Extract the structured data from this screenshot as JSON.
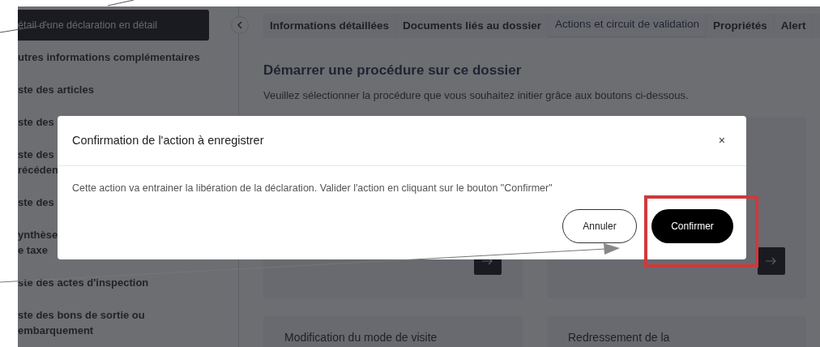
{
  "sidebar": {
    "items": [
      {
        "lines": [
          "étail d'une déclaration en détail"
        ],
        "selected": true
      },
      {
        "lines": [
          "utres informations complémentaires"
        ],
        "selected": false
      },
      {
        "lines": [
          "ste des articles"
        ],
        "selected": false
      },
      {
        "lines": [
          "ste des"
        ],
        "selected": false
      },
      {
        "lines": [
          "ste des",
          "récéden"
        ],
        "selected": false
      },
      {
        "lines": [
          "ste des"
        ],
        "selected": false
      },
      {
        "lines": [
          "ynthèse",
          "e taxe"
        ],
        "selected": false
      },
      {
        "lines": [
          "ste des actes d'inspection"
        ],
        "selected": false
      },
      {
        "lines": [
          "ste des bons de sortie ou",
          "embarquement"
        ],
        "selected": false
      }
    ]
  },
  "tabs": [
    {
      "label": "Informations détaillées",
      "selected": false
    },
    {
      "label": "Documents liés au dossier",
      "selected": false
    },
    {
      "label": "Actions et circuit de validation",
      "selected": true
    },
    {
      "label": "Propriétés",
      "selected": false
    },
    {
      "label": "Alert",
      "selected": false
    }
  ],
  "section": {
    "title": "Démarrer une procédure sur ce dossier",
    "subtitle": "Veuillez sélectionner la procédure que vous souhaitez initier grâce aux boutons ci-dessous."
  },
  "cards": [
    {
      "kind": "action"
    },
    {
      "kind": "action"
    },
    {
      "kind": "titled",
      "title": "Modification du mode de visite"
    },
    {
      "kind": "titled",
      "title": "Redressement de la"
    }
  ],
  "modal": {
    "title": "Confirmation de l'action à enregistrer",
    "close": "×",
    "message": "Cette action va entrainer la libération de la déclaration. Valider l'action en cliquant sur le bouton \"Confirmer\"",
    "buttons": [
      {
        "label": "Annuler",
        "kind": "secondary"
      },
      {
        "label": "Confirmer",
        "kind": "primary"
      }
    ]
  }
}
